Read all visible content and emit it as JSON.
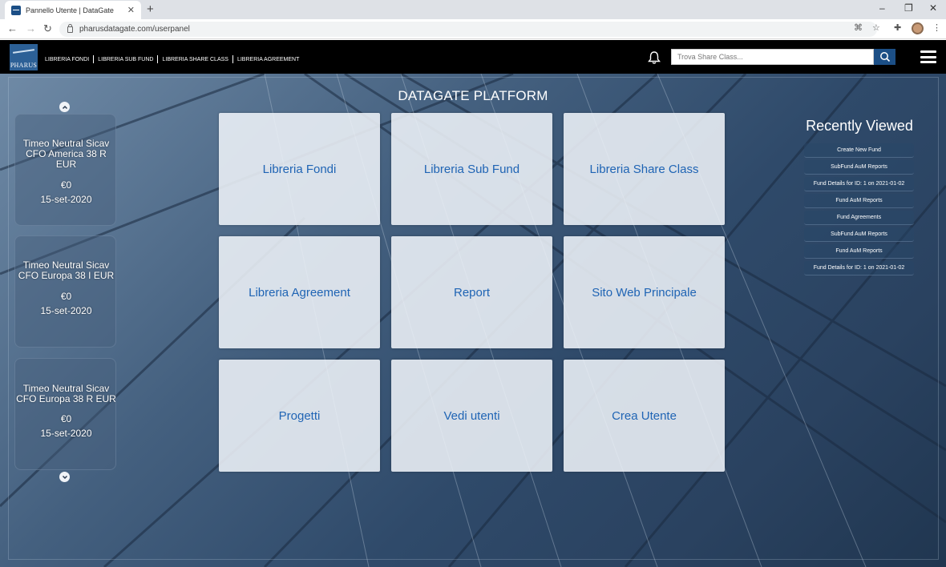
{
  "browser": {
    "tab_title": "Pannello Utente | DataGate",
    "url": "pharusdatagate.com/userpanel"
  },
  "header": {
    "logo_text": "PHARUS",
    "nav": [
      "LIBRERIA FONDI",
      "LIBRERIA SUB FUND",
      "LIBRERIA SHARE CLASS",
      "LIBRERIA AGREEMENT"
    ],
    "search_placeholder": "Trova Share Class..."
  },
  "carousel": {
    "items": [
      {
        "name": "Timeo Neutral Sicav CFO America 38 R EUR",
        "value": "€0",
        "date": "15-set-2020"
      },
      {
        "name": "Timeo Neutral Sicav CFO Europa 38 I EUR",
        "value": "€0",
        "date": "15-set-2020"
      },
      {
        "name": "Timeo Neutral Sicav CFO Europa 38 R EUR",
        "value": "€0",
        "date": "15-set-2020"
      }
    ]
  },
  "main": {
    "title": "DATAGATE PLATFORM",
    "tiles": [
      "Libreria Fondi",
      "Libreria Sub Fund",
      "Libreria Share Class",
      "Libreria Agreement",
      "Report",
      "Sito Web Principale",
      "Progetti",
      "Vedi utenti",
      "Crea Utente"
    ]
  },
  "recently_viewed": {
    "title": "Recently Viewed",
    "items": [
      "Create New Fund",
      "SubFund AuM Reports",
      "Fund Details for ID: 1 on 2021-01-02",
      "Fund AuM Reports",
      "Fund Agreements",
      "SubFund AuM Reports",
      "Fund AuM Reports",
      "Fund Details for ID: 1 on 2021-01-02"
    ]
  },
  "colors": {
    "header_bg": "#000000",
    "accent": "#1c4f86",
    "tile_text": "#1f64b4"
  }
}
